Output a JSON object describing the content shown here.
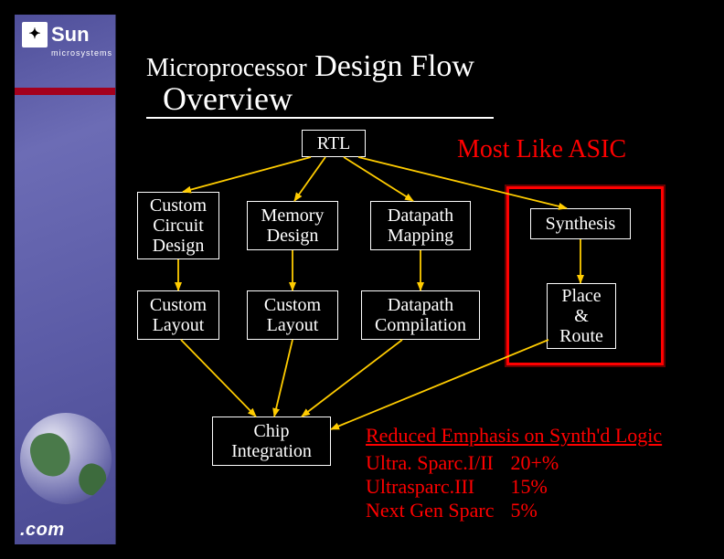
{
  "branding": {
    "logo_word": "Sun",
    "logo_small": "microsystems",
    "dotcom": ".com"
  },
  "title": {
    "row1_small": "Microprocessor",
    "row1_big": "Design Flow",
    "row2": "Overview"
  },
  "top_right": "Most Like ASIC",
  "boxes": {
    "rtl": "RTL",
    "ccd_l1": "Custom",
    "ccd_l2": "Circuit",
    "ccd_l3": "Design",
    "mem_l1": "Memory",
    "mem_l2": "Design",
    "dpm_l1": "Datapath",
    "dpm_l2": "Mapping",
    "syn": "Synthesis",
    "cl1_l1": "Custom",
    "cl1_l2": "Layout",
    "cl2_l1": "Custom",
    "cl2_l2": "Layout",
    "dpc_l1": "Datapath",
    "dpc_l2": "Compilation",
    "pnr_l1": "Place",
    "pnr_l2": "&",
    "pnr_l3": "Route",
    "chip_l1": "Chip",
    "chip_l2": "Integration"
  },
  "emphasis": {
    "header": "Reduced Emphasis on Synth'd Logic",
    "rows": [
      {
        "name": "Ultra. Sparc.I/II",
        "pct": "20+%"
      },
      {
        "name": "Ultrasparc.III",
        "pct": "15%"
      },
      {
        "name": "Next Gen Sparc",
        "pct": "5%"
      }
    ]
  },
  "chart_data": {
    "type": "flow-diagram",
    "nodes": [
      {
        "id": "rtl",
        "label": "RTL"
      },
      {
        "id": "ccd",
        "label": "Custom Circuit Design"
      },
      {
        "id": "mem",
        "label": "Memory Design"
      },
      {
        "id": "dpm",
        "label": "Datapath Mapping"
      },
      {
        "id": "syn",
        "label": "Synthesis",
        "highlight": "Most Like ASIC"
      },
      {
        "id": "cl1",
        "label": "Custom Layout"
      },
      {
        "id": "cl2",
        "label": "Custom Layout"
      },
      {
        "id": "dpc",
        "label": "Datapath Compilation"
      },
      {
        "id": "pnr",
        "label": "Place & Route",
        "highlight": "Most Like ASIC"
      },
      {
        "id": "chip",
        "label": "Chip Integration"
      }
    ],
    "edges": [
      [
        "rtl",
        "ccd"
      ],
      [
        "rtl",
        "mem"
      ],
      [
        "rtl",
        "dpm"
      ],
      [
        "rtl",
        "syn"
      ],
      [
        "ccd",
        "cl1"
      ],
      [
        "mem",
        "cl2"
      ],
      [
        "dpm",
        "dpc"
      ],
      [
        "syn",
        "pnr"
      ],
      [
        "cl1",
        "chip"
      ],
      [
        "cl2",
        "chip"
      ],
      [
        "dpc",
        "chip"
      ],
      [
        "pnr",
        "chip"
      ]
    ],
    "annotation": {
      "title": "Reduced Emphasis on Synth'd Logic",
      "series": [
        {
          "name": "Ultra. Sparc.I/II",
          "value_text": "20+%"
        },
        {
          "name": "Ultrasparc.III",
          "value_text": "15%"
        },
        {
          "name": "Next Gen Sparc",
          "value_text": "5%"
        }
      ]
    }
  }
}
